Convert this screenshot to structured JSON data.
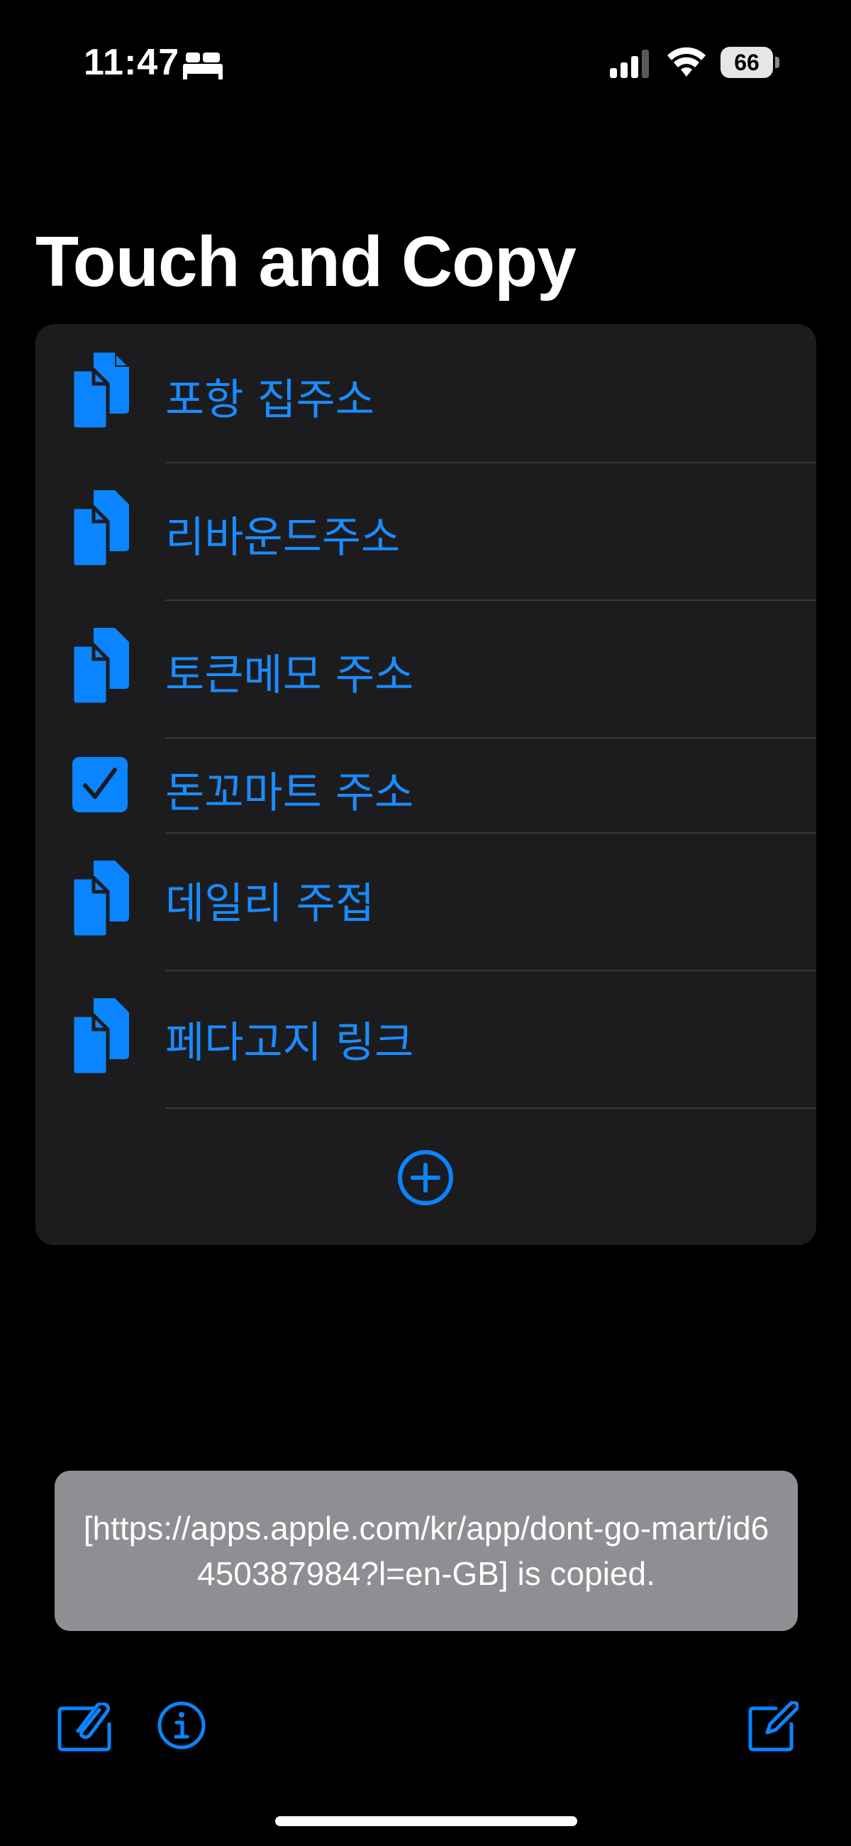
{
  "status_bar": {
    "time": "11:47",
    "battery": "66",
    "icons": [
      "bed-icon",
      "cellular-signal-icon",
      "wifi-icon",
      "battery-icon"
    ]
  },
  "title": "Touch and Copy",
  "accent_color": "#0a84ff",
  "items": [
    {
      "label": "포항 집주소",
      "icon": "copy-documents-icon"
    },
    {
      "label": "리바운드주소",
      "icon": "copy-documents-icon"
    },
    {
      "label": "토큰메모 주소",
      "icon": "copy-documents-icon"
    },
    {
      "label": "돈꼬마트 주소",
      "icon": "checkmark-square-icon"
    },
    {
      "label": "데일리 주접",
      "icon": "copy-documents-icon"
    },
    {
      "label": "페다고지 링크",
      "icon": "copy-documents-icon"
    }
  ],
  "add_icon": "plus-circle-icon",
  "toast": {
    "message": "[https://apps.apple.com/kr/app/dont-go-mart/id6450387984?l=en-GB] is copied."
  },
  "toolbar": {
    "left_icons": [
      "clipboard-attach-icon",
      "info-circle-icon"
    ],
    "right_icon": "compose-icon"
  }
}
